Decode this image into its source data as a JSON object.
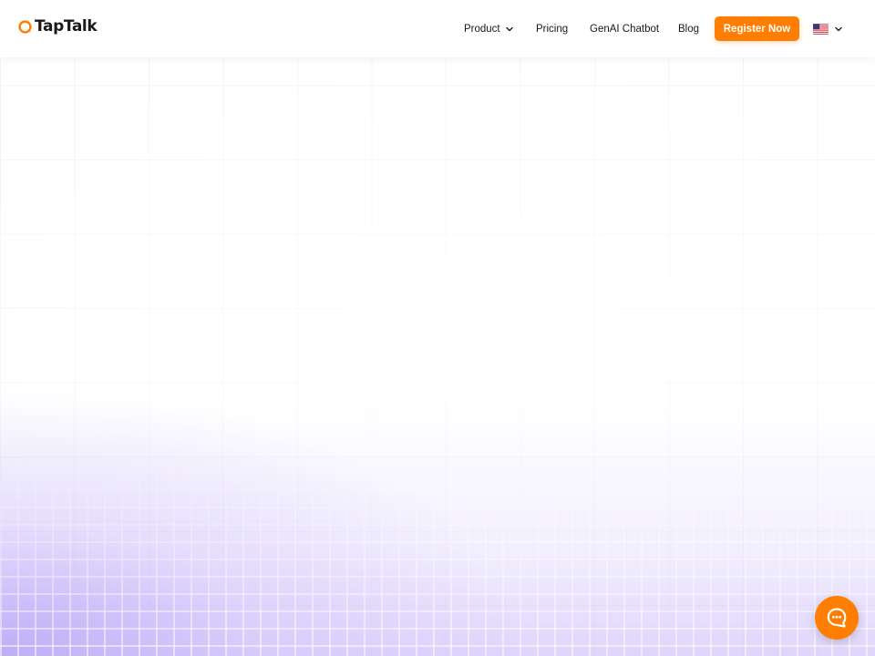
{
  "brand": {
    "name": "TapTalk",
    "logo_icon": "chat-bubble-logo-icon",
    "accent_color": "#ff7d00"
  },
  "nav": {
    "items": [
      {
        "label": "Product",
        "has_dropdown": true
      },
      {
        "label": "Pricing",
        "has_dropdown": false
      },
      {
        "label": "GenAI Chatbot",
        "has_dropdown": false
      },
      {
        "label": "Blog",
        "has_dropdown": false
      }
    ],
    "cta_label": "Register Now",
    "language": {
      "icon": "us-flag-icon",
      "has_dropdown": true
    }
  },
  "chat_launcher": {
    "icon": "chat-bubble-icon"
  },
  "theme": {
    "hero_glow_color": "#b4a0f5",
    "header_bg": "#ffffff",
    "text_color": "#191919"
  }
}
